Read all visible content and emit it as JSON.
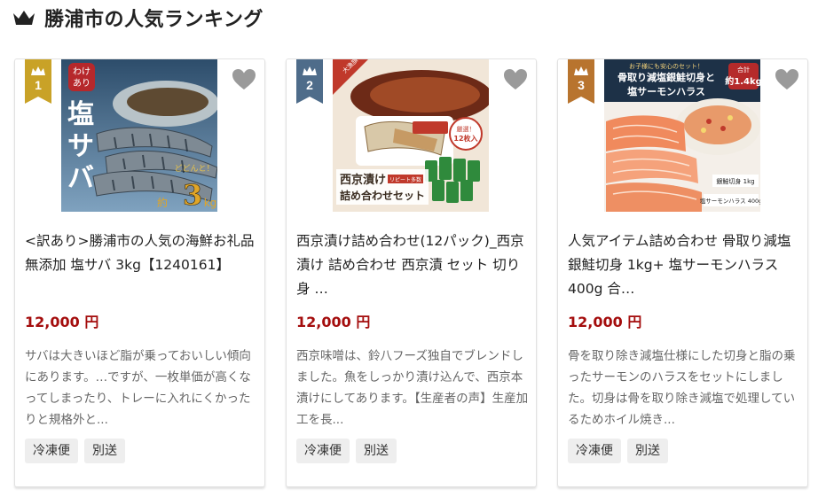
{
  "section": {
    "title": "勝浦市の人気ランキング",
    "icon": "crown-icon"
  },
  "colors": {
    "price": "#a40d0d",
    "rank1": "#c9a227",
    "rank2": "#4e6c8a",
    "rank3": "#b8742e"
  },
  "products": [
    {
      "rank": "1",
      "title": "<訳あり>勝浦市の人気の海鮮お礼品 無添加 塩サバ 3kg【1240161】",
      "price": "12,000 円",
      "description": "サバは大きいほど脂が乗っておいしい傾向にあります。…ですが、一枚単価が高くなってしまったり、トレーに入れにくかったりと規格外と...",
      "tags": [
        "冷凍便",
        "別送"
      ],
      "image_text": {
        "badge": "わけあり",
        "main": "塩サバ",
        "sub": "どどんと！",
        "weight": "約3kg"
      }
    },
    {
      "rank": "2",
      "title": "西京漬け詰め合わせ(12パック)_西京漬け 詰め合わせ 西京漬 セット 切り身 …",
      "price": "12,000 円",
      "description": "西京味噌は、鈴八フーズ独自でブレンドしました。魚をしっかり漬け込んで、西京本漬けにしてあります。【生産者の声】生産加工を長...",
      "tags": [
        "冷凍便",
        "別送"
      ],
      "image_text": {
        "corner": "大漁旗",
        "badge": "厳選！12枚入",
        "main": "西京漬け詰め合わせセット",
        "sub": "リピート多数"
      }
    },
    {
      "rank": "3",
      "title": "人気アイテム詰め合わせ 骨取り減塩銀鮭切身 1kg+ 塩サーモンハラス 400g 合…",
      "price": "12,000 円",
      "description": "骨を取り除き減塩仕様にした切身と脂の乗ったサーモンのハラスをセットにしました。切身は骨を取り除き減塩で処理しているためホイル焼き...",
      "tags": [
        "冷凍便",
        "別送"
      ],
      "image_text": {
        "top": "お子様にも安心のセット！",
        "main1": "骨取り減塩銀鮭切身と",
        "main2": "塩サーモンハラス",
        "total": "合計 約1.4kg",
        "label1": "銀鮭切身 1kg",
        "label2": "塩サーモンハラス 400g"
      }
    }
  ]
}
